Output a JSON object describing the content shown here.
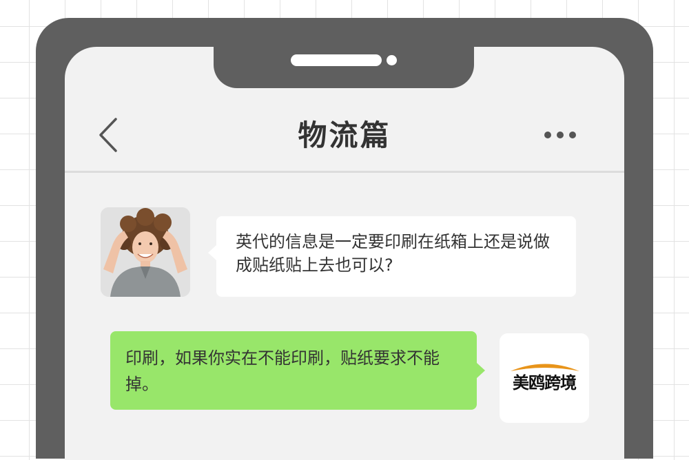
{
  "header": {
    "title": "物流篇",
    "back_icon": "chevron-left-icon",
    "more_icon": "more-horizontal-icon"
  },
  "messages": [
    {
      "sender": "customer",
      "text": "英代的信息是一定要印刷在纸箱上还是说做成贴纸贴上去也可以?"
    },
    {
      "sender": "brand",
      "text": "印刷，如果你实在不能印刷，贴纸要求不能掉。"
    }
  ],
  "brand": {
    "logo_text": "美鸥跨境"
  },
  "colors": {
    "phone_frame": "#5f5f5f",
    "screen_bg": "#f2f2f2",
    "incoming_bubble": "#ffffff",
    "outgoing_bubble": "#98e66a",
    "brand_swoosh": "#e8941a"
  }
}
